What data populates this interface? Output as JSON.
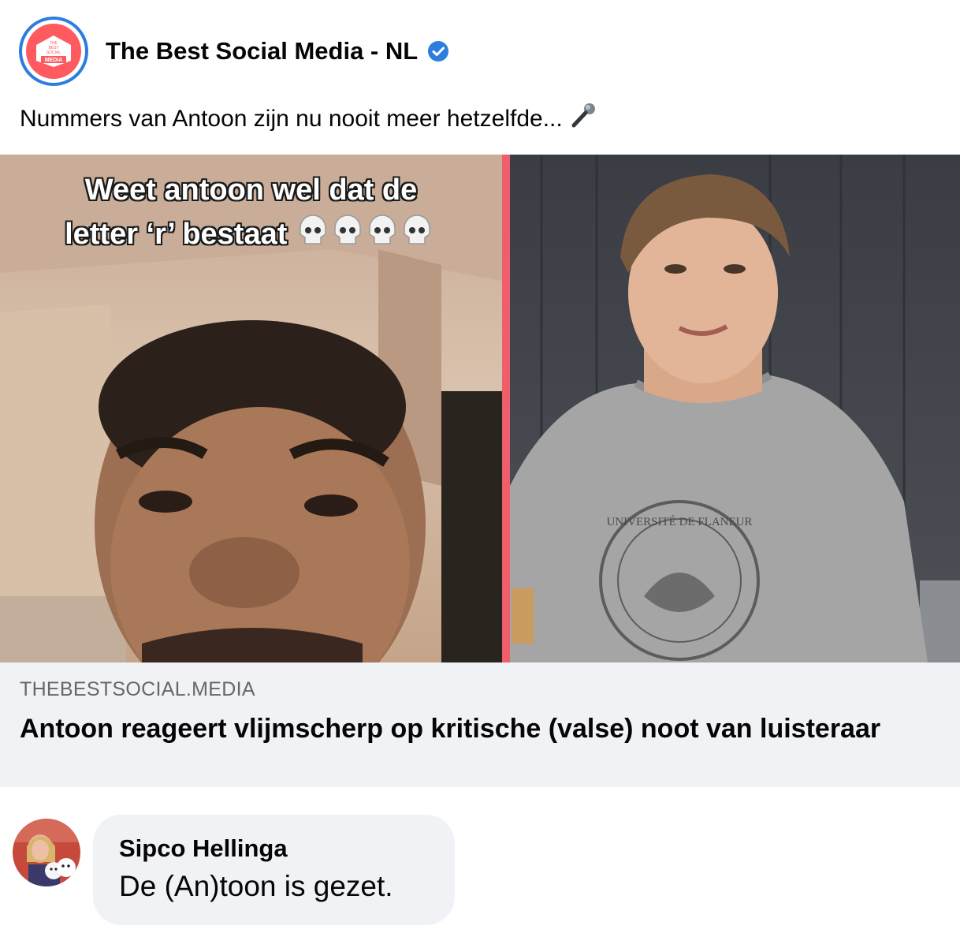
{
  "post": {
    "page_name": "The Best Social Media - NL",
    "avatar_text": "THE BEST SOCIAL MEDIA",
    "avatar_line1": "THE",
    "avatar_line2": "BEST",
    "avatar_line3": "SOCIAL",
    "avatar_line4": "MEDIA",
    "verified": true,
    "text": "Nummers van Antoon zijn nu nooit meer hetzelfde...",
    "text_emoji": "microphone-icon"
  },
  "media": {
    "overlay_line1": "Weet antoon wel dat de",
    "overlay_line2": "letter ‘r’ bestaat",
    "overlay_emojis": "skull-icon x4",
    "sweater_text": "UNIVERSITÉ DE FLANEUR",
    "accent_divider": "#ef5f6b"
  },
  "link": {
    "domain": "THEBESTSOCIAL.MEDIA",
    "title": "Antoon reageert vlijmscherp op kritische (valse) noot van luisteraar"
  },
  "comment": {
    "author": "Sipco Hellinga",
    "text": "De (An)toon is gezet."
  },
  "colors": {
    "verified_blue": "#2d7de0",
    "avatar_red": "#ff5a5f",
    "preview_bg": "#f0f2f5",
    "secondary_text": "#65676b"
  }
}
